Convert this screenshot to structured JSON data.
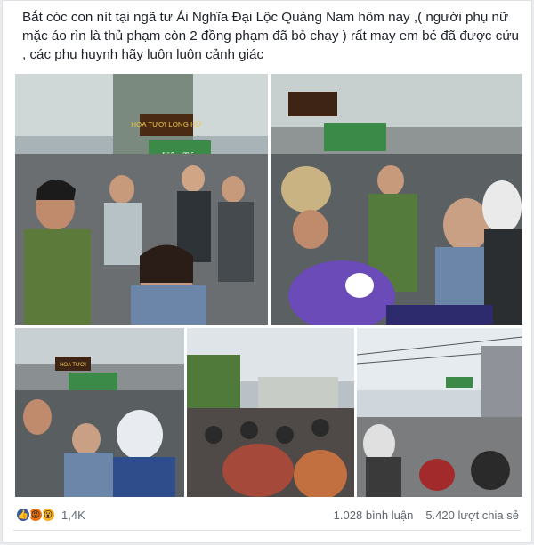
{
  "post": {
    "text": "Bắt cóc con nít tại ngã tư Ái Nghĩa Đại Lộc Quảng Nam hôm nay ,( người phụ nữ mặc áo rìn là thủ phạm còn 2 đồng phạm đã bỏ chạy ) rất may em bé đã được cứu , các phụ huynh hãy luôn luôn cảnh giác"
  },
  "photos": {
    "sign_top": "HOA TƯƠI LONG HỮ",
    "sign_green": "Uôn Tóc",
    "sign_bottom": "HOA TƯƠI"
  },
  "reactions": {
    "icons": [
      "like-icon",
      "angry-icon",
      "wow-icon"
    ],
    "count": "1,4K"
  },
  "stats": {
    "comments": "1.028 bình luận",
    "shares": "5.420 lượt chia sẻ"
  },
  "colors": {
    "link_blue": "#3b5998",
    "muted": "#606770"
  }
}
